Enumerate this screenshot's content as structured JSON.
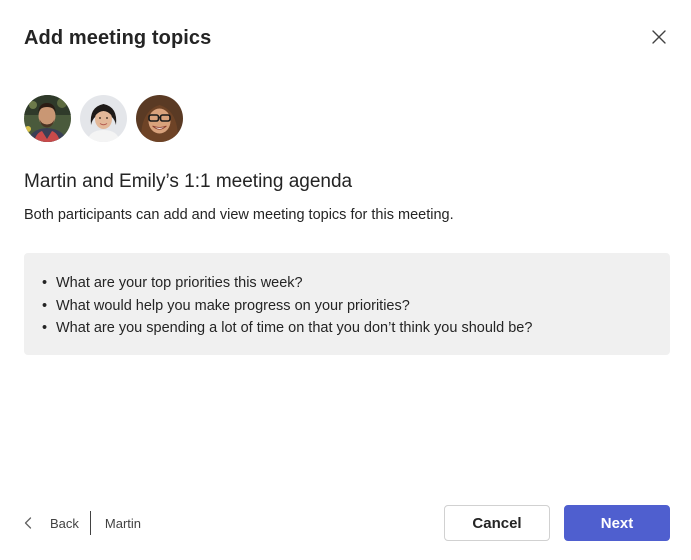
{
  "dialog": {
    "title": "Add meeting topics",
    "close_icon": "close-icon"
  },
  "participants": [
    {
      "name": "avatar-1"
    },
    {
      "name": "avatar-2"
    },
    {
      "name": "avatar-3"
    }
  ],
  "agenda": {
    "title": "Martin and Emily’s 1:1 meeting agenda",
    "description": "Both participants can add and view meeting topics for this meeting.",
    "bullet": "•",
    "topics": [
      "What are your top priorities this week?",
      "What would help you make progress on your priorities?",
      "What are you spending a lot of time on that you don’t think you should be?"
    ]
  },
  "footer": {
    "back_icon": "chevron-left-icon",
    "back_label": "Back",
    "breadcrumb_name": "Martin",
    "cancel_label": "Cancel",
    "next_label": "Next"
  },
  "colors": {
    "primary": "#4f5fcf",
    "topics_background": "#f0f0f0",
    "text": "#242424"
  }
}
